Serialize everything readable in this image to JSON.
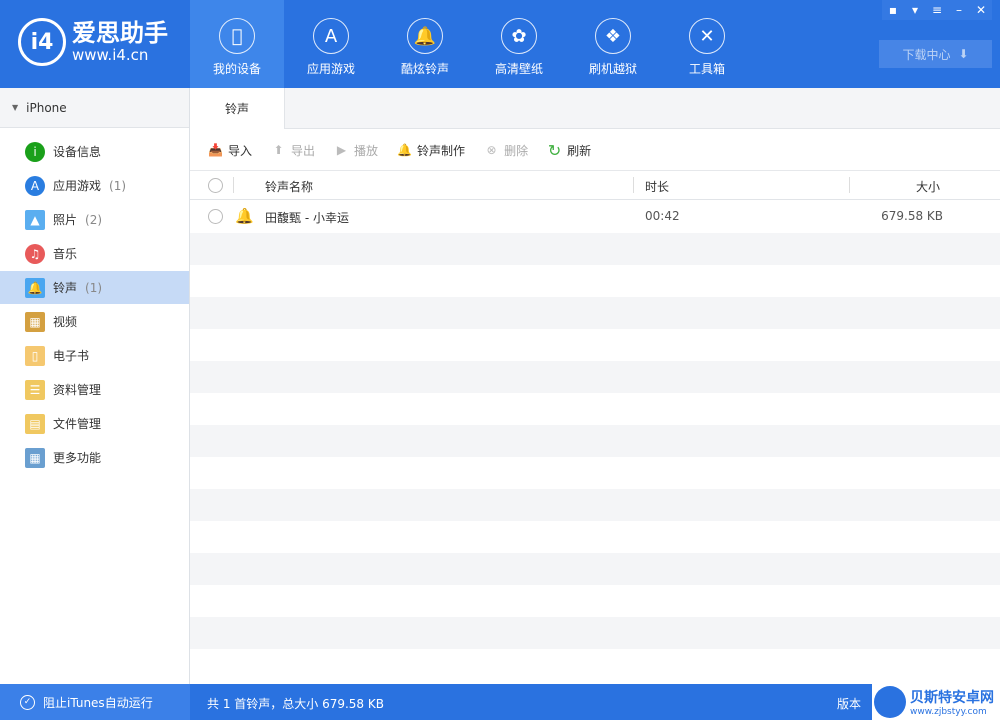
{
  "app": {
    "logo_title": "爱思助手",
    "logo_url": "www.i4.cn",
    "logo_mark": "i4"
  },
  "nav": [
    {
      "label": "我的设备",
      "icon": "apple-icon"
    },
    {
      "label": "应用游戏",
      "icon": "app-store-icon"
    },
    {
      "label": "酷炫铃声",
      "icon": "bell-icon"
    },
    {
      "label": "高清壁纸",
      "icon": "flower-icon"
    },
    {
      "label": "刷机越狱",
      "icon": "box-icon"
    },
    {
      "label": "工具箱",
      "icon": "tools-icon"
    }
  ],
  "window_buttons": [
    "feedback",
    "skin",
    "menu",
    "minimize",
    "close"
  ],
  "download_center": "下载中心",
  "sidebar": {
    "device": "iPhone",
    "items": [
      {
        "label": "设备信息",
        "count": "",
        "icon": "info-icon",
        "color": "#1aa01a"
      },
      {
        "label": "应用游戏",
        "count": "(1)",
        "icon": "app-store-icon",
        "color": "#2a7de0"
      },
      {
        "label": "照片",
        "count": "(2)",
        "icon": "photo-icon",
        "color": "#5aaef0"
      },
      {
        "label": "音乐",
        "count": "",
        "icon": "music-icon",
        "color": "#e85a5a"
      },
      {
        "label": "铃声",
        "count": "(1)",
        "icon": "bell-icon",
        "color": "#4aa6f0",
        "selected": true
      },
      {
        "label": "视频",
        "count": "",
        "icon": "video-icon",
        "color": "#d4a040"
      },
      {
        "label": "电子书",
        "count": "",
        "icon": "book-icon",
        "color": "#f5c870"
      },
      {
        "label": "资料管理",
        "count": "",
        "icon": "contacts-icon",
        "color": "#f0c860"
      },
      {
        "label": "文件管理",
        "count": "",
        "icon": "file-icon",
        "color": "#f0c860"
      },
      {
        "label": "更多功能",
        "count": "",
        "icon": "grid-icon",
        "color": "#6a9fd0"
      }
    ]
  },
  "tab": "铃声",
  "toolbar": [
    {
      "label": "导入",
      "enabled": true
    },
    {
      "label": "导出",
      "enabled": false
    },
    {
      "label": "播放",
      "enabled": false
    },
    {
      "label": "铃声制作",
      "enabled": true
    },
    {
      "label": "删除",
      "enabled": false
    },
    {
      "label": "刷新",
      "enabled": true
    }
  ],
  "table": {
    "headers": {
      "name": "铃声名称",
      "duration": "时长",
      "size": "大小"
    },
    "rows": [
      {
        "name": "田馥甄 - 小幸运",
        "duration": "00:42",
        "size": "679.58 KB"
      }
    ]
  },
  "status": {
    "itunes": "阻止iTunes自动运行",
    "summary": "共 1 首铃声，总大小 679.58 KB",
    "version": "版本"
  },
  "watermark": {
    "title": "贝斯特安卓网",
    "url": "www.zjbstyy.com"
  }
}
